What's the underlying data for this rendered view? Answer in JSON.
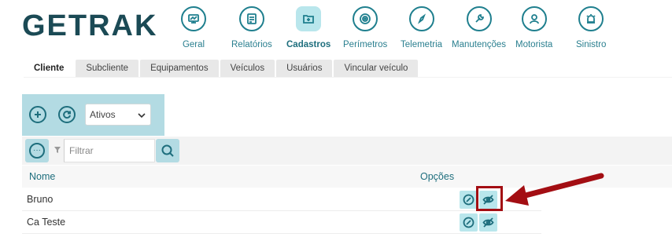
{
  "app": {
    "logo_text": "GETRAK"
  },
  "nav": [
    {
      "label": "Geral",
      "icon": "chart-monitor-icon",
      "active": false
    },
    {
      "label": "Relatórios",
      "icon": "report-icon",
      "active": false
    },
    {
      "label": "Cadastros",
      "icon": "folder-add-icon",
      "active": true
    },
    {
      "label": "Perímetros",
      "icon": "perimeter-target-icon",
      "active": false
    },
    {
      "label": "Telemetria",
      "icon": "compass-icon",
      "active": false
    },
    {
      "label": "Manutenções",
      "icon": "wrench-icon",
      "active": false
    },
    {
      "label": "Motorista",
      "icon": "driver-icon",
      "active": false
    },
    {
      "label": "Sinistro",
      "icon": "alarm-siren-icon",
      "active": false
    }
  ],
  "tabs": [
    {
      "label": "Cliente",
      "active": true
    },
    {
      "label": "Subcliente",
      "active": false
    },
    {
      "label": "Equipamentos",
      "active": false
    },
    {
      "label": "Veículos",
      "active": false
    },
    {
      "label": "Usuários",
      "active": false
    },
    {
      "label": "Vincular veículo",
      "active": false
    }
  ],
  "toolbar": {
    "status_value": "Ativos"
  },
  "filter": {
    "placeholder": "Filtrar"
  },
  "table": {
    "headers": {
      "name": "Nome",
      "options": "Opções"
    },
    "rows": [
      {
        "name": "Bruno"
      },
      {
        "name": "Ca Teste"
      }
    ]
  },
  "annotation": {
    "color": "#a30e13"
  },
  "colors": {
    "accent": "#1e6e7d",
    "toolbar_bg": "#b3dbe3",
    "button_bg": "#b9e6ec"
  }
}
